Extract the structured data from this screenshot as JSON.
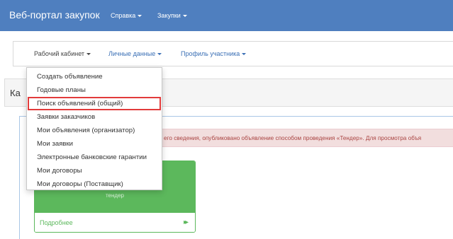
{
  "header": {
    "brand": "Веб-портал закупок",
    "nav": [
      {
        "label": "Справка"
      },
      {
        "label": "Закупки"
      }
    ]
  },
  "subnav": {
    "items": [
      {
        "label": "Рабочий кабинет",
        "active": true
      },
      {
        "label": "Личные данные"
      },
      {
        "label": "Профиль участника"
      }
    ]
  },
  "page": {
    "heading_fragment": "Ка"
  },
  "alert": {
    "text": "его сведения, опубликовано объявление способом проведения «Тендер». Для просмотра объя"
  },
  "card": {
    "subtitle": "тендер",
    "more_label": "Подробнее",
    "arrow_glyph": "▸▸"
  },
  "dropdown": {
    "items": [
      {
        "label": "Создать объявление"
      },
      {
        "label": "Годовые планы"
      },
      {
        "label": "Поиск объявлений (общий)",
        "highlighted": true
      },
      {
        "label": "Заявки заказчиков"
      },
      {
        "label": "Мои объявления (организатор)"
      },
      {
        "label": "Мои заявки"
      },
      {
        "label": "Электронные банковские гарантии"
      },
      {
        "label": "Мои договоры"
      },
      {
        "label": "Мои договоры (Поставщик)"
      }
    ]
  },
  "colors": {
    "header_bg": "#4f7fbf",
    "link": "#3a6fb5",
    "success": "#5cb85c",
    "alert_bg": "#f2dede",
    "alert_text": "#a94442",
    "highlight_border": "#e23b3b"
  }
}
